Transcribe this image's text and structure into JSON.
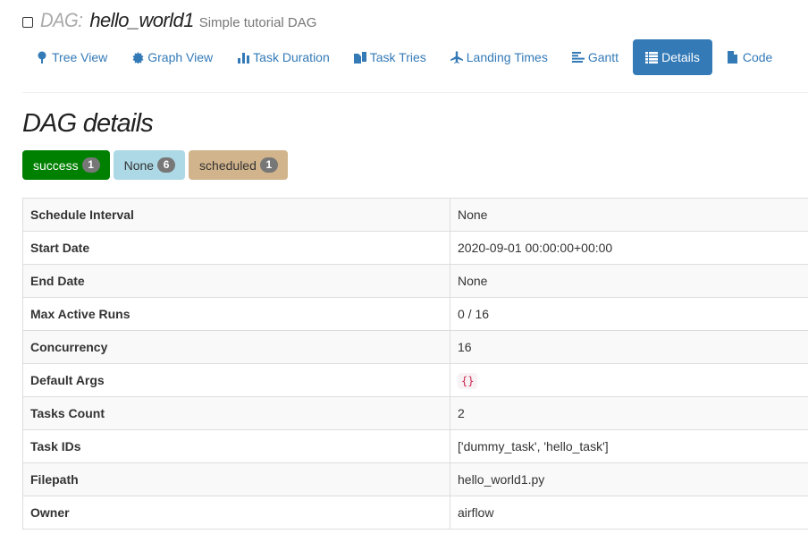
{
  "header": {
    "prefix": "DAG:",
    "dag_id": "hello_world1",
    "description": "Simple tutorial DAG"
  },
  "nav": {
    "items": [
      {
        "label": "Tree View",
        "icon": "tree-icon",
        "active": false
      },
      {
        "label": "Graph View",
        "icon": "certificate-icon",
        "active": false
      },
      {
        "label": "Task Duration",
        "icon": "stats-icon",
        "active": false
      },
      {
        "label": "Task Tries",
        "icon": "duplicate-icon",
        "active": false
      },
      {
        "label": "Landing Times",
        "icon": "plane-icon",
        "active": false
      },
      {
        "label": "Gantt",
        "icon": "align-left-icon",
        "active": false
      },
      {
        "label": "Details",
        "icon": "list-icon",
        "active": true
      },
      {
        "label": "Code",
        "icon": "file-icon",
        "active": false
      }
    ],
    "colors": {
      "link": "#337ab7",
      "active_bg": "#337ab7"
    }
  },
  "section_title": "DAG details",
  "states": [
    {
      "label": "success",
      "count": "1",
      "color": "#008000"
    },
    {
      "label": "None",
      "count": "6",
      "color": "#add8e6"
    },
    {
      "label": "scheduled",
      "count": "1",
      "color": "#d2b48c"
    }
  ],
  "details": {
    "rows": [
      {
        "key": "Schedule Interval",
        "value": "None"
      },
      {
        "key": "Start Date",
        "value": "2020-09-01 00:00:00+00:00"
      },
      {
        "key": "End Date",
        "value": "None"
      },
      {
        "key": "Max Active Runs",
        "value": "0 / 16"
      },
      {
        "key": "Concurrency",
        "value": "16"
      },
      {
        "key": "Default Args",
        "value": "{}"
      },
      {
        "key": "Tasks Count",
        "value": "2"
      },
      {
        "key": "Task IDs",
        "value": "['dummy_task', 'hello_task']"
      },
      {
        "key": "Filepath",
        "value": "hello_world1.py"
      },
      {
        "key": "Owner",
        "value": "airflow"
      }
    ]
  }
}
